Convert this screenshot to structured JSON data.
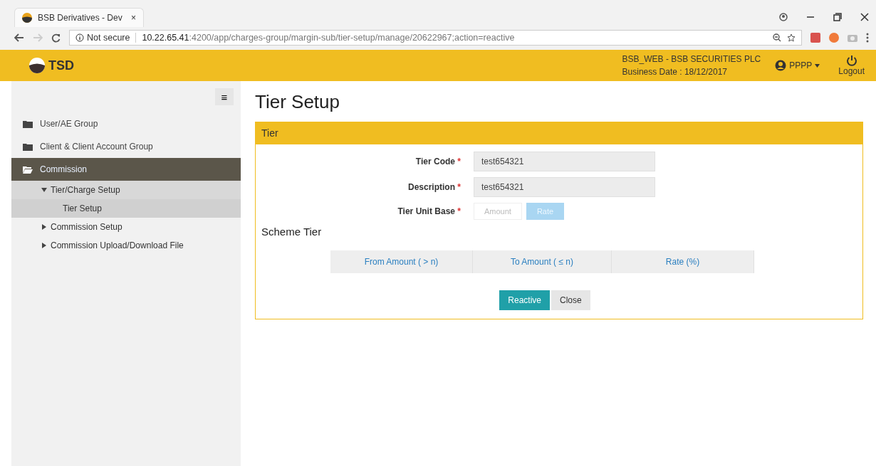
{
  "browser": {
    "tab_title": "BSB Derivatives - Dev",
    "tab_close": "×",
    "security": "Not secure",
    "url": "**10.22.65.41**:4200/app/charges-group/margin-sub/tier-setup/manage/20622967;action=reactive"
  },
  "header": {
    "logo": "TSD",
    "company": "BSB_WEB - BSB SECURITIES PLC",
    "business_date": "Business Date : 18/12/2017",
    "user": "PPPP",
    "logout": "Logout"
  },
  "sidebar": {
    "toggle": "≡",
    "items": [
      {
        "label": "User/AE Group",
        "expanded": false,
        "selected": false
      },
      {
        "label": "Client & Client Account Group",
        "expanded": false,
        "selected": false
      },
      {
        "label": "Commission",
        "expanded": true,
        "selected": true,
        "children": [
          {
            "label": "Tier/Charge Setup",
            "expanded": true,
            "selected": true,
            "children": [
              {
                "label": "Tier Setup",
                "selected": true
              }
            ]
          },
          {
            "label": "Commission Setup",
            "expanded": false,
            "selected": false
          },
          {
            "label": "Commission Upload/Download File",
            "expanded": false,
            "selected": false
          }
        ]
      }
    ]
  },
  "page_title": "Tier Setup",
  "panel": {
    "title": "Tier",
    "fields": [
      {
        "label": "Tier Code",
        "required_mark": "*",
        "value": "test654321"
      },
      {
        "label": "Description",
        "required_mark": "*",
        "value": "test654321"
      }
    ],
    "unit_base": {
      "label": "Tier Unit Base",
      "required_mark": "*",
      "options": [
        {
          "label": "Amount",
          "selected": false
        },
        {
          "label": "Rate",
          "selected": true
        }
      ]
    },
    "section_title": "Scheme Tier",
    "table": {
      "columns": [
        "From Amount ( > n)",
        "To Amount ( ≤ n)",
        "Rate (%)"
      ]
    },
    "buttons": [
      {
        "label": "Reactive",
        "kind": "primary"
      },
      {
        "label": "Close",
        "kind": "default"
      }
    ]
  }
}
